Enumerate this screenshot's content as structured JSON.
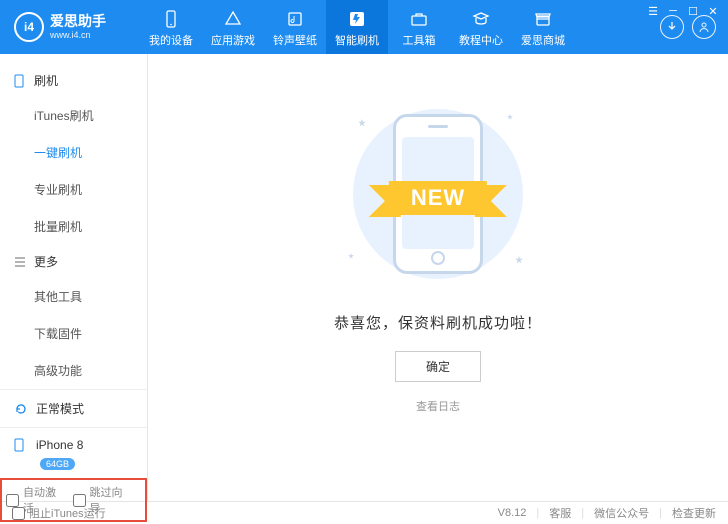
{
  "logo": {
    "title": "爱思助手",
    "url": "www.i4.cn"
  },
  "nav": [
    {
      "label": "我的设备",
      "icon": "device-icon"
    },
    {
      "label": "应用游戏",
      "icon": "apps-icon"
    },
    {
      "label": "铃声壁纸",
      "icon": "music-icon"
    },
    {
      "label": "智能刷机",
      "icon": "flash-icon",
      "active": true
    },
    {
      "label": "工具箱",
      "icon": "toolbox-icon"
    },
    {
      "label": "教程中心",
      "icon": "tutorial-icon"
    },
    {
      "label": "爱思商城",
      "icon": "shop-icon"
    }
  ],
  "sidebar": {
    "section1": {
      "title": "刷机",
      "items": [
        "iTunes刷机",
        "一键刷机",
        "专业刷机",
        "批量刷机"
      ],
      "activeIndex": 1
    },
    "section2": {
      "title": "更多",
      "items": [
        "其他工具",
        "下载固件",
        "高级功能"
      ]
    },
    "mode": "正常模式",
    "device": {
      "name": "iPhone 8",
      "badge": "64GB"
    },
    "checkboxes": {
      "auto_activate": "自动激活",
      "skip_guide": "跳过向导"
    }
  },
  "main": {
    "ribbon": "NEW",
    "success_text": "恭喜您，保资料刷机成功啦！",
    "ok_button": "确定",
    "view_log": "查看日志"
  },
  "footer": {
    "block_itunes": "阻止iTunes运行",
    "version": "V8.12",
    "links": [
      "客服",
      "微信公众号",
      "检查更新"
    ]
  }
}
